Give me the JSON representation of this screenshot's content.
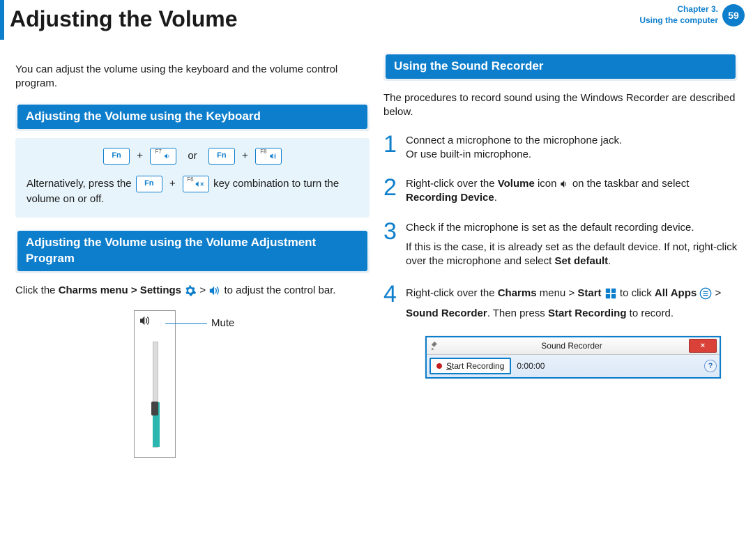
{
  "header": {
    "title": "Adjusting the Volume",
    "chapter_line1": "Chapter 3.",
    "chapter_line2": "Using the computer",
    "page": "59"
  },
  "left": {
    "intro": "You can adjust the volume using the keyboard and the volume control program.",
    "sec1_title": "Adjusting the Volume using the Keyboard",
    "box": {
      "fn": "Fn",
      "f7": "F7",
      "f8": "F8",
      "f6": "F6",
      "plus": "+",
      "or": "or",
      "alt_pre": "Alternatively, press the ",
      "alt_post": " key combination to turn the volume on or off."
    },
    "sec2_title": "Adjusting the Volume using the Volume Adjustment Program",
    "charms_pre": "Click the ",
    "charms_bold": "Charms menu > Settings",
    "charms_mid": " > ",
    "charms_post": " to adjust the control bar.",
    "mute_label": "Mute"
  },
  "right": {
    "sec_title": "Using the Sound Recorder",
    "intro": "The procedures to record sound using the Windows Recorder are described below.",
    "step1a": "Connect a microphone to the microphone jack.",
    "step1b": "Or use built-in microphone.",
    "step2_pre": "Right-click over the ",
    "step2_vol": "Volume",
    "step2_mid": " icon ",
    "step2_post": " on the taskbar and select ",
    "step2_bold2": "Recording Device",
    "step3a": "Check if the microphone is set as the default recording device.",
    "step3b_pre": "If this is the case, it is already set as the default device. If not, right-click over the microphone and select ",
    "step3b_bold": "Set default",
    "step4_pre": "Right-click over the ",
    "step4_b1": "Charms",
    "step4_m1": " menu > ",
    "step4_b2": "Start",
    "step4_m2": " to click ",
    "step4_b3": "All Apps",
    "step4_m3": " > ",
    "step4_b4": "Sound Recorder",
    "step4_m4": ". Then press ",
    "step4_b5": "Start Recording",
    "step4_m5": " to record.",
    "recorder": {
      "title": "Sound Recorder",
      "btn": "Start Recording",
      "u_char": "S",
      "btn_rest": "tart Recording",
      "time": "0:00:00",
      "close": "×",
      "help": "?"
    }
  }
}
